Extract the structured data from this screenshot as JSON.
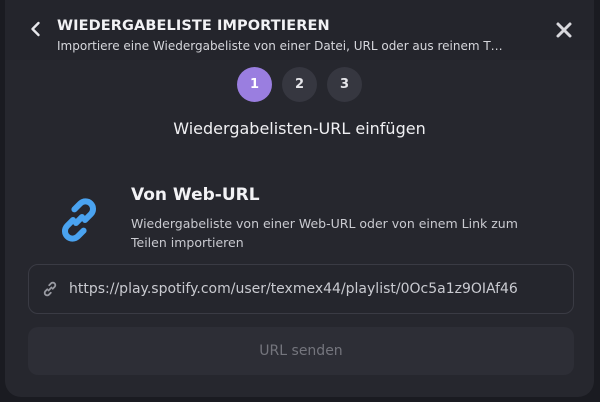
{
  "header": {
    "title": "WIEDERGABELISTE IMPORTIEREN",
    "subtitle": "Importiere eine Wiedergabeliste von einer Datei, URL oder aus reinem T…"
  },
  "steps": {
    "items": [
      "1",
      "2",
      "3"
    ],
    "active_index": 0,
    "current_title": "Wiedergabelisten-URL einfügen"
  },
  "source": {
    "icon": "link-icon",
    "title": "Von Web-URL",
    "description": "Wiedergabeliste von einer Web-URL oder von einem Link zum Teilen importieren"
  },
  "url_field": {
    "icon": "link-icon",
    "value": "https://play.spotify.com/user/texmex44/playlist/0Oc5a1z9OIAf46"
  },
  "submit": {
    "label": "URL senden",
    "enabled": false
  },
  "colors": {
    "accent": "#9a7ee0",
    "link_icon": "#4aa3f0",
    "modal_bg": "#26272e"
  }
}
